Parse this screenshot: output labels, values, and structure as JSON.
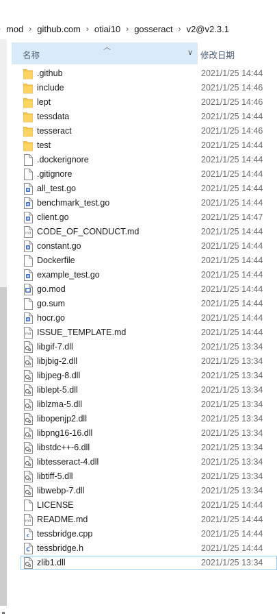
{
  "breadcrumb": [
    "mod",
    "github.com",
    "otiai10",
    "gosseract",
    "v2@v2.3.1"
  ],
  "columns": {
    "name": "名称",
    "date": "修改日期"
  },
  "files": [
    {
      "name": ".github",
      "date": "2021/1/25 14:44",
      "icon": "folder-icon"
    },
    {
      "name": "include",
      "date": "2021/1/25 14:46",
      "icon": "folder-icon"
    },
    {
      "name": "lept",
      "date": "2021/1/25 14:46",
      "icon": "folder-icon"
    },
    {
      "name": "tessdata",
      "date": "2021/1/25 14:44",
      "icon": "folder-icon"
    },
    {
      "name": "tesseract",
      "date": "2021/1/25 14:46",
      "icon": "folder-icon"
    },
    {
      "name": "test",
      "date": "2021/1/25 14:44",
      "icon": "folder-icon"
    },
    {
      "name": ".dockerignore",
      "date": "2021/1/25 14:44",
      "icon": "file-icon"
    },
    {
      "name": ".gitignore",
      "date": "2021/1/25 14:44",
      "icon": "file-icon"
    },
    {
      "name": "all_test.go",
      "date": "2021/1/25 14:44",
      "icon": "go-file-icon"
    },
    {
      "name": "benchmark_test.go",
      "date": "2021/1/25 14:44",
      "icon": "go-file-icon"
    },
    {
      "name": "client.go",
      "date": "2021/1/25 14:47",
      "icon": "go-file-icon"
    },
    {
      "name": "CODE_OF_CONDUCT.md",
      "date": "2021/1/25 14:44",
      "icon": "markdown-file-icon"
    },
    {
      "name": "constant.go",
      "date": "2021/1/25 14:44",
      "icon": "go-file-icon"
    },
    {
      "name": "Dockerfile",
      "date": "2021/1/25 14:44",
      "icon": "file-icon"
    },
    {
      "name": "example_test.go",
      "date": "2021/1/25 14:44",
      "icon": "go-file-icon"
    },
    {
      "name": "go.mod",
      "date": "2021/1/25 14:44",
      "icon": "mod-file-icon"
    },
    {
      "name": "go.sum",
      "date": "2021/1/25 14:44",
      "icon": "file-icon"
    },
    {
      "name": "hocr.go",
      "date": "2021/1/25 14:44",
      "icon": "go-file-icon"
    },
    {
      "name": "ISSUE_TEMPLATE.md",
      "date": "2021/1/25 14:44",
      "icon": "markdown-file-icon"
    },
    {
      "name": "libgif-7.dll",
      "date": "2021/1/25 13:34",
      "icon": "dll-file-icon"
    },
    {
      "name": "libjbig-2.dll",
      "date": "2021/1/25 13:34",
      "icon": "dll-file-icon"
    },
    {
      "name": "libjpeg-8.dll",
      "date": "2021/1/25 13:34",
      "icon": "dll-file-icon"
    },
    {
      "name": "liblept-5.dll",
      "date": "2021/1/25 13:34",
      "icon": "dll-file-icon"
    },
    {
      "name": "liblzma-5.dll",
      "date": "2021/1/25 13:34",
      "icon": "dll-file-icon"
    },
    {
      "name": "libopenjp2.dll",
      "date": "2021/1/25 13:34",
      "icon": "dll-file-icon"
    },
    {
      "name": "libpng16-16.dll",
      "date": "2021/1/25 13:34",
      "icon": "dll-file-icon"
    },
    {
      "name": "libstdc++-6.dll",
      "date": "2021/1/25 13:34",
      "icon": "dll-file-icon"
    },
    {
      "name": "libtesseract-4.dll",
      "date": "2021/1/25 13:34",
      "icon": "dll-file-icon"
    },
    {
      "name": "libtiff-5.dll",
      "date": "2021/1/25 13:34",
      "icon": "dll-file-icon"
    },
    {
      "name": "libwebp-7.dll",
      "date": "2021/1/25 13:34",
      "icon": "dll-file-icon"
    },
    {
      "name": "LICENSE",
      "date": "2021/1/25 14:44",
      "icon": "file-icon"
    },
    {
      "name": "README.md",
      "date": "2021/1/25 14:44",
      "icon": "markdown-file-icon"
    },
    {
      "name": "tessbridge.cpp",
      "date": "2021/1/25 14:44",
      "icon": "cpp-file-icon"
    },
    {
      "name": "tessbridge.h",
      "date": "2021/1/25 14:44",
      "icon": "c-header-file-icon"
    },
    {
      "name": "zlib1.dll",
      "date": "2021/1/25 13:34",
      "icon": "dll-file-icon",
      "selected": true
    }
  ],
  "colors": {
    "folder": "#f7c94b",
    "header_hover": "#d9ebf9",
    "selection_border": "#99d1ff",
    "date_text": "#6d6d6d",
    "go_badge": "#3a6fc4"
  }
}
